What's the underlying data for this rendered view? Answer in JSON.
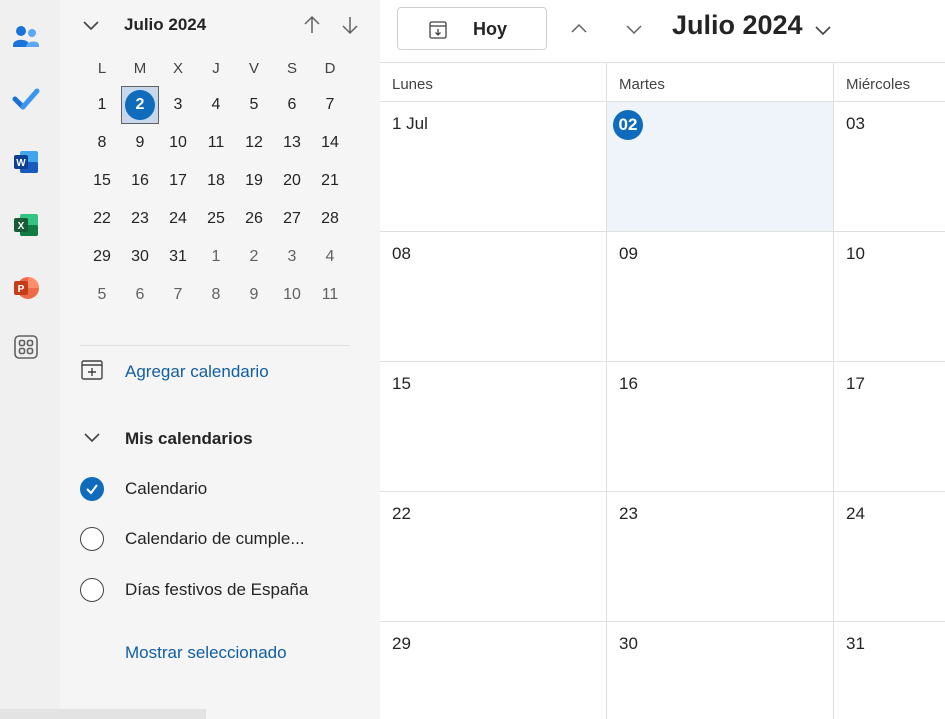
{
  "rail": {
    "apps": [
      {
        "name": "people-icon"
      },
      {
        "name": "todo-icon"
      },
      {
        "name": "word-icon",
        "letter": "W"
      },
      {
        "name": "excel-icon",
        "letter": "X"
      },
      {
        "name": "powerpoint-icon",
        "letter": "P"
      },
      {
        "name": "apps-icon"
      }
    ]
  },
  "mini_calendar": {
    "title": "Julio 2024",
    "weekdays": [
      "L",
      "M",
      "X",
      "J",
      "V",
      "S",
      "D"
    ],
    "weeks": [
      [
        "1",
        "2",
        "3",
        "4",
        "5",
        "6",
        "7"
      ],
      [
        "8",
        "9",
        "10",
        "11",
        "12",
        "13",
        "14"
      ],
      [
        "15",
        "16",
        "17",
        "18",
        "19",
        "20",
        "21"
      ],
      [
        "22",
        "23",
        "24",
        "25",
        "26",
        "27",
        "28"
      ],
      [
        "29",
        "30",
        "31",
        "1",
        "2",
        "3",
        "4"
      ],
      [
        "5",
        "6",
        "7",
        "8",
        "9",
        "10",
        "11"
      ]
    ],
    "selected": "2"
  },
  "sidebar": {
    "add_calendar": "Agregar calendario",
    "my_calendars": "Mis calendarios",
    "calendars": [
      {
        "label": "Calendario",
        "checked": true
      },
      {
        "label": "Calendario de cumple...",
        "checked": false
      },
      {
        "label": "Días festivos de España",
        "checked": false
      }
    ],
    "show_selected": "Mostrar seleccionado"
  },
  "toolbar": {
    "today_label": "Hoy",
    "title": "Julio 2024"
  },
  "month_view": {
    "day_headers": [
      "Lunes",
      "Martes",
      "Miércoles"
    ],
    "rows": [
      [
        "1 Jul",
        "02",
        "03"
      ],
      [
        "08",
        "09",
        "10"
      ],
      [
        "15",
        "16",
        "17"
      ],
      [
        "22",
        "23",
        "24"
      ],
      [
        "29",
        "30",
        "31"
      ]
    ],
    "today": "02"
  },
  "colors": {
    "accent": "#0f6cbd",
    "link": "#115ea3",
    "today_bg": "#eff4fa"
  }
}
